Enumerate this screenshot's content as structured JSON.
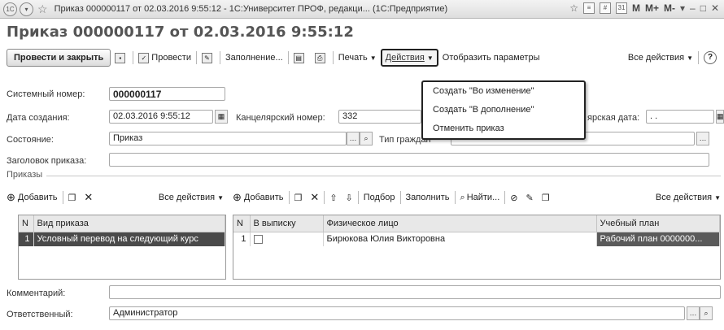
{
  "window": {
    "title": "Приказ 000000117 от 02.03.2016 9:55:12 - 1С:Университет ПРОФ, редакци... (1С:Предприятие)"
  },
  "heading": "Приказ 000000117 от 02.03.2016 9:55:12",
  "toolbar": {
    "post_close": "Провести и закрыть",
    "post": "Провести",
    "fill": "Заполнение...",
    "print": "Печать",
    "actions": "Действия",
    "show_params": "Отобразить параметры",
    "all_actions": "Все действия"
  },
  "actions_menu": {
    "items": [
      "Создать \"Во изменение\"",
      "Создать \"В дополнение\"",
      "Отменить приказ"
    ]
  },
  "fields": {
    "system_number_label": "Системный номер:",
    "system_number": "000000117",
    "created_label": "Дата создания:",
    "created": "02.03.2016  9:55:12",
    "office_number_label": "Канцелярский номер:",
    "office_number": "332",
    "office_date_label": "ярская дата:",
    "office_date": " .  .",
    "state_label": "Состояние:",
    "state": "Приказ",
    "citizen_type_label": "Тип граждан",
    "header_label": "Заголовок приказа:",
    "header": "",
    "comment_label": "Комментарий:",
    "comment": "",
    "responsible_label": "Ответственный:",
    "responsible": "Администратор"
  },
  "orders_section": {
    "title": "Приказы",
    "left_toolbar": {
      "add": "Добавить",
      "all_actions": "Все действия"
    },
    "right_toolbar": {
      "add": "Добавить",
      "selection": "Подбор",
      "fill": "Заполнить",
      "find": "Найти...",
      "all_actions": "Все действия"
    }
  },
  "left_table": {
    "columns": [
      "N",
      "Вид приказа"
    ],
    "rows": [
      [
        "1",
        "Условный перевод на следующий курс"
      ]
    ]
  },
  "right_table": {
    "columns": [
      "N",
      "В выписку",
      "Физическое лицо",
      "Учебный план"
    ],
    "rows": [
      [
        "1",
        "",
        "Бирюкова Юлия Викторовна",
        "Рабочий план 0000000..."
      ]
    ]
  }
}
